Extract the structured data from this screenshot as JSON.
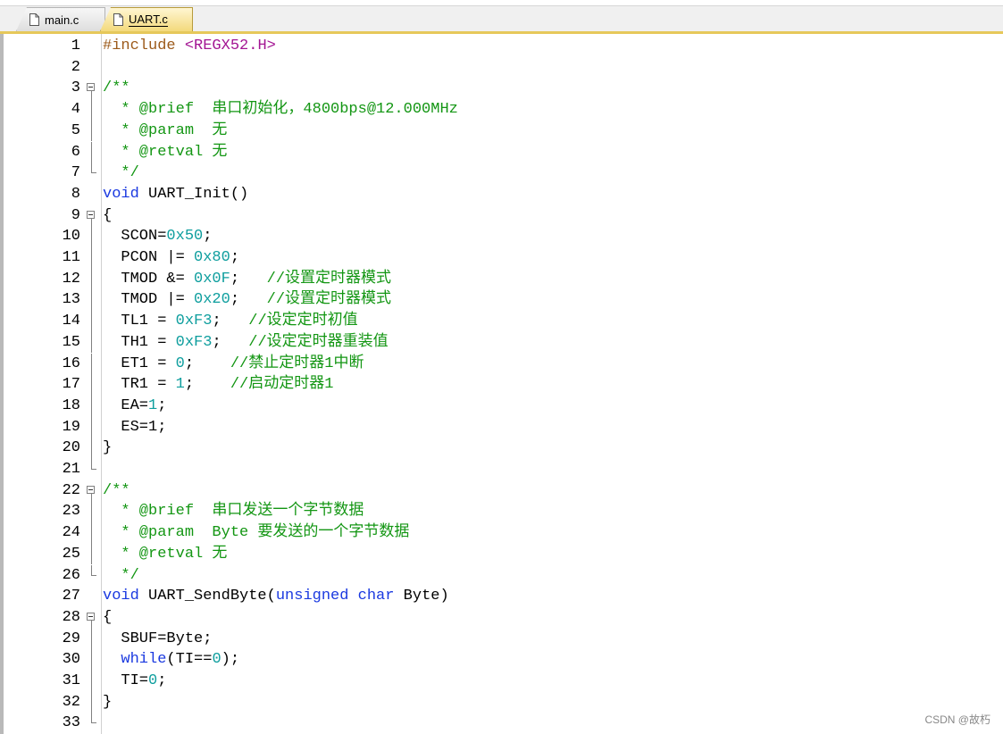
{
  "tabs": [
    {
      "label": "main.c",
      "active": false
    },
    {
      "label": "UART.c",
      "active": true
    }
  ],
  "colors": {
    "preprocessor": "#9c5a1a",
    "string": "#a31593",
    "comment": "#139613",
    "keyword": "#1a39e0",
    "number": "#0e9e9e",
    "active_tab_accent": "#e6c85a"
  },
  "fold_markers": {
    "open_lines": [
      3,
      9,
      22,
      28
    ],
    "end_lines": [
      7,
      21,
      26,
      33
    ]
  },
  "lines": [
    {
      "n": "1",
      "tokens": [
        [
          "pp",
          "#include "
        ],
        [
          "str",
          "<REGX52.H>"
        ]
      ]
    },
    {
      "n": "2",
      "tokens": []
    },
    {
      "n": "3",
      "tokens": [
        [
          "cmt",
          "/**"
        ]
      ]
    },
    {
      "n": "4",
      "tokens": [
        [
          "cmt",
          "  * @brief  串口初始化，4800bps@12.000MHz"
        ]
      ]
    },
    {
      "n": "5",
      "tokens": [
        [
          "cmt",
          "  * @param  无"
        ]
      ]
    },
    {
      "n": "6",
      "tokens": [
        [
          "cmt",
          "  * @retval 无"
        ]
      ]
    },
    {
      "n": "7",
      "tokens": [
        [
          "cmt",
          "  */"
        ]
      ]
    },
    {
      "n": "8",
      "tokens": [
        [
          "kw",
          "void"
        ],
        [
          "plain",
          " UART_Init()"
        ]
      ]
    },
    {
      "n": "9",
      "tokens": [
        [
          "plain",
          "{"
        ]
      ]
    },
    {
      "n": "10",
      "tokens": [
        [
          "plain",
          "  SCON="
        ],
        [
          "num",
          "0x50"
        ],
        [
          "plain",
          ";"
        ]
      ]
    },
    {
      "n": "11",
      "tokens": [
        [
          "plain",
          "  PCON |= "
        ],
        [
          "num",
          "0x80"
        ],
        [
          "plain",
          ";"
        ]
      ]
    },
    {
      "n": "12",
      "tokens": [
        [
          "plain",
          "  TMOD &= "
        ],
        [
          "num",
          "0x0F"
        ],
        [
          "plain",
          ";   "
        ],
        [
          "cmt",
          "//设置定时器模式"
        ]
      ]
    },
    {
      "n": "13",
      "tokens": [
        [
          "plain",
          "  TMOD |= "
        ],
        [
          "num",
          "0x20"
        ],
        [
          "plain",
          ";   "
        ],
        [
          "cmt",
          "//设置定时器模式"
        ]
      ]
    },
    {
      "n": "14",
      "tokens": [
        [
          "plain",
          "  TL1 = "
        ],
        [
          "num",
          "0xF3"
        ],
        [
          "plain",
          ";   "
        ],
        [
          "cmt",
          "//设定定时初值"
        ]
      ]
    },
    {
      "n": "15",
      "tokens": [
        [
          "plain",
          "  TH1 = "
        ],
        [
          "num",
          "0xF3"
        ],
        [
          "plain",
          ";   "
        ],
        [
          "cmt",
          "//设定定时器重装值"
        ]
      ]
    },
    {
      "n": "16",
      "tokens": [
        [
          "plain",
          "  ET1 = "
        ],
        [
          "num",
          "0"
        ],
        [
          "plain",
          ";    "
        ],
        [
          "cmt",
          "//禁止定时器1中断"
        ]
      ]
    },
    {
      "n": "17",
      "tokens": [
        [
          "plain",
          "  TR1 = "
        ],
        [
          "num",
          "1"
        ],
        [
          "plain",
          ";    "
        ],
        [
          "cmt",
          "//启动定时器1"
        ]
      ]
    },
    {
      "n": "18",
      "tokens": [
        [
          "plain",
          "  EA="
        ],
        [
          "num",
          "1"
        ],
        [
          "plain",
          ";"
        ]
      ]
    },
    {
      "n": "19",
      "tokens": [
        [
          "plain",
          "  ES=1;"
        ]
      ]
    },
    {
      "n": "20",
      "tokens": [
        [
          "plain",
          "}"
        ]
      ]
    },
    {
      "n": "21",
      "tokens": []
    },
    {
      "n": "22",
      "tokens": [
        [
          "cmt",
          "/**"
        ]
      ]
    },
    {
      "n": "23",
      "tokens": [
        [
          "cmt",
          "  * @brief  串口发送一个字节数据"
        ]
      ]
    },
    {
      "n": "24",
      "tokens": [
        [
          "cmt",
          "  * @param  Byte 要发送的一个字节数据"
        ]
      ]
    },
    {
      "n": "25",
      "tokens": [
        [
          "cmt",
          "  * @retval 无"
        ]
      ]
    },
    {
      "n": "26",
      "tokens": [
        [
          "cmt",
          "  */"
        ]
      ]
    },
    {
      "n": "27",
      "tokens": [
        [
          "kw",
          "void"
        ],
        [
          "plain",
          " UART_SendByte("
        ],
        [
          "kw",
          "unsigned char"
        ],
        [
          "plain",
          " Byte)"
        ]
      ]
    },
    {
      "n": "28",
      "tokens": [
        [
          "plain",
          "{"
        ]
      ]
    },
    {
      "n": "29",
      "tokens": [
        [
          "plain",
          "  SBUF=Byte;"
        ]
      ]
    },
    {
      "n": "30",
      "tokens": [
        [
          "plain",
          "  "
        ],
        [
          "kw",
          "while"
        ],
        [
          "plain",
          "(TI=="
        ],
        [
          "num",
          "0"
        ],
        [
          "plain",
          ");"
        ]
      ]
    },
    {
      "n": "31",
      "tokens": [
        [
          "plain",
          "  TI="
        ],
        [
          "num",
          "0"
        ],
        [
          "plain",
          ";"
        ]
      ]
    },
    {
      "n": "32",
      "tokens": [
        [
          "plain",
          "}"
        ]
      ]
    },
    {
      "n": "33",
      "tokens": []
    }
  ],
  "watermark": "CSDN @故朽"
}
